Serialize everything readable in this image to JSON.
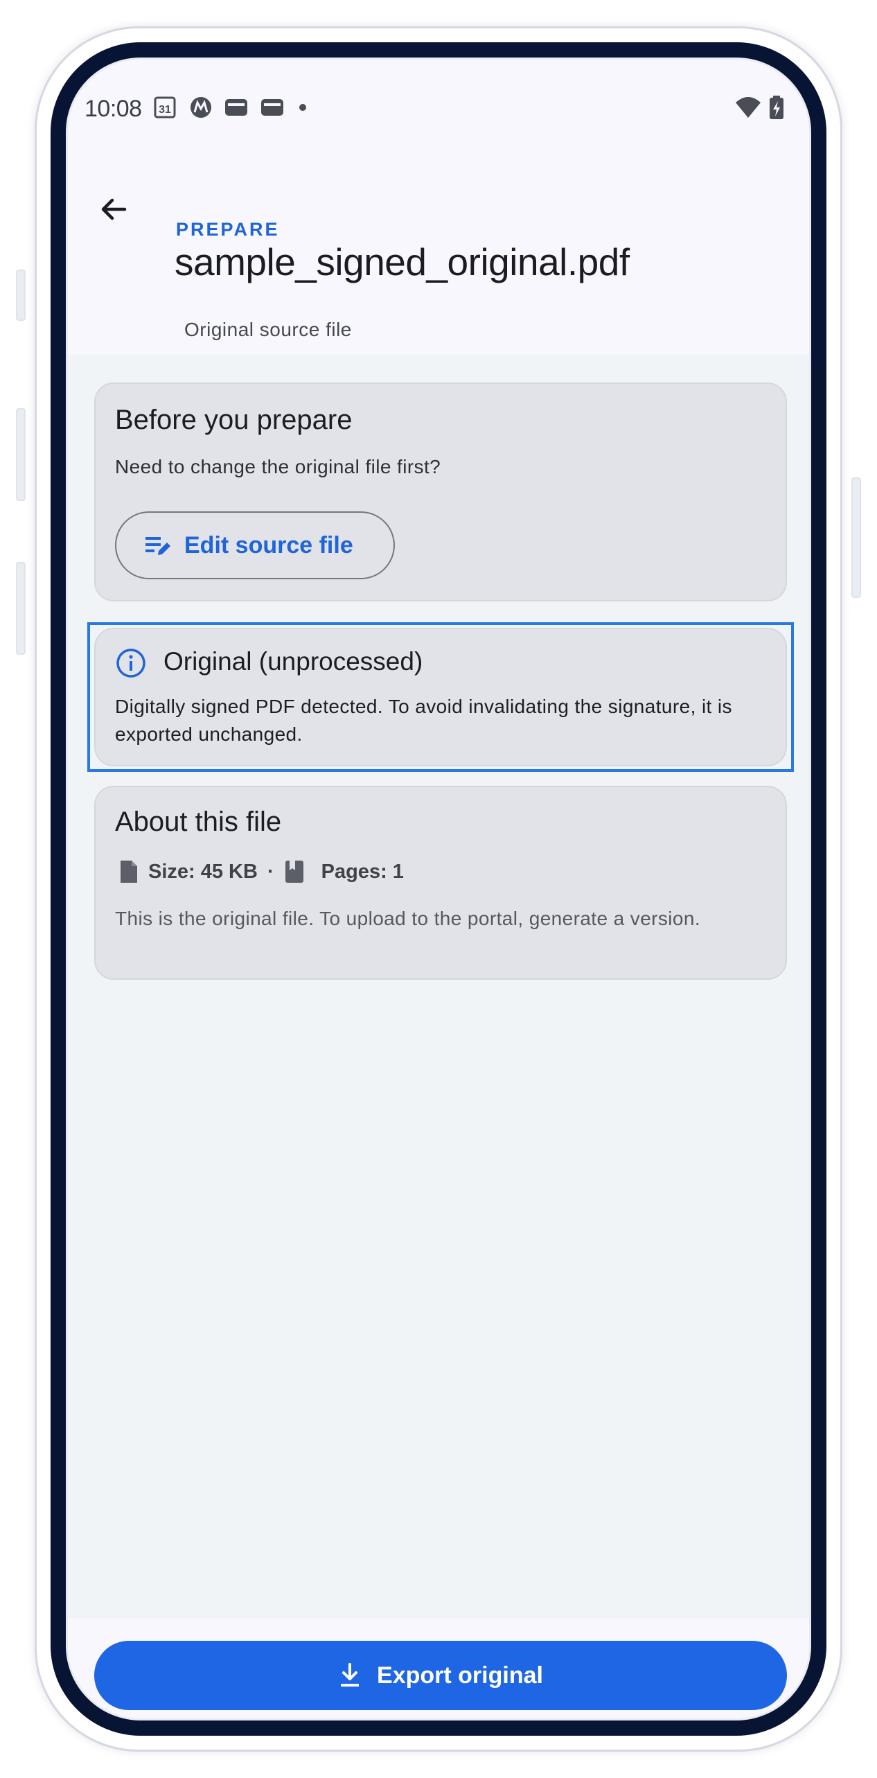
{
  "status_bar": {
    "time": "10:08",
    "icons_left": [
      "calendar-31-icon",
      "motorola-icon",
      "wallet-icon",
      "wallet-icon",
      "dot-icon"
    ],
    "calendar_day": "31",
    "icons_right": [
      "wifi-icon",
      "battery-charging-icon"
    ]
  },
  "header": {
    "kicker": "PREPARE",
    "title": "sample_signed_original.pdf",
    "subtitle": "Original source file"
  },
  "before_card": {
    "title": "Before you prepare",
    "text": "Need to change the original file first?",
    "button_label": "Edit source file"
  },
  "notice_card": {
    "title": "Original (unprocessed)",
    "text": "Digitally signed PDF detected. To avoid invalidating the signature, it is exported unchanged."
  },
  "about_card": {
    "title": "About this file",
    "size": "Size: 45 KB",
    "separator": "·",
    "pages": "Pages: 1",
    "note": "This is the original file. To upload to the portal, generate a version."
  },
  "footer": {
    "export_label": "Export original"
  },
  "colors": {
    "accent": "#1f66e5",
    "card_bg": "#e2e3e8",
    "focus": "#2a79e0"
  }
}
